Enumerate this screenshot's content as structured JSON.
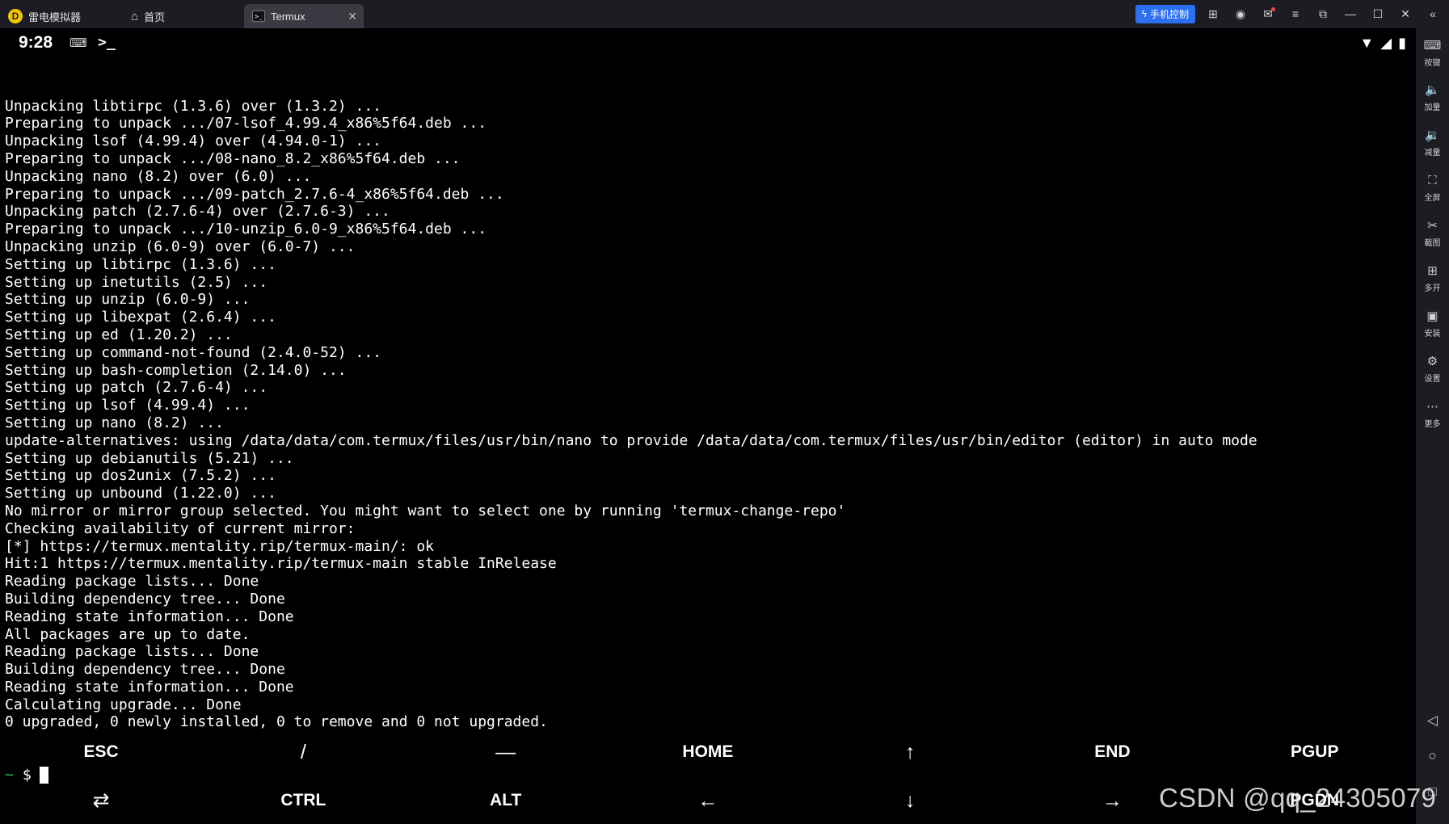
{
  "titlebar": {
    "tabs": [
      {
        "label": "雷电模拟器",
        "icon": "leidian-logo-icon"
      },
      {
        "label": "首页",
        "icon": "home-icon"
      },
      {
        "label": "Termux",
        "icon": "termux-icon",
        "active": true
      }
    ],
    "phone_control_label": "手机控制",
    "right_icons": [
      "gamepad-icon",
      "user-icon",
      "mail-icon",
      "menu-icon",
      "window-restore-icon",
      "minimize-icon",
      "maximize-icon",
      "close-icon",
      "collapse-icon"
    ],
    "accent_color": "#2c6ff0"
  },
  "statusbar": {
    "time": "9:28",
    "icons": [
      "keyboard-icon",
      "terminal-prompt-icon",
      "wifi-icon",
      "signal-icon",
      "battery-icon"
    ]
  },
  "terminal": {
    "lines": [
      "Unpacking libtirpc (1.3.6) over (1.3.2) ...",
      "Preparing to unpack .../07-lsof_4.99.4_x86%5f64.deb ...",
      "Unpacking lsof (4.99.4) over (4.94.0-1) ...",
      "Preparing to unpack .../08-nano_8.2_x86%5f64.deb ...",
      "Unpacking nano (8.2) over (6.0) ...",
      "Preparing to unpack .../09-patch_2.7.6-4_x86%5f64.deb ...",
      "Unpacking patch (2.7.6-4) over (2.7.6-3) ...",
      "Preparing to unpack .../10-unzip_6.0-9_x86%5f64.deb ...",
      "Unpacking unzip (6.0-9) over (6.0-7) ...",
      "Setting up libtirpc (1.3.6) ...",
      "Setting up inetutils (2.5) ...",
      "Setting up unzip (6.0-9) ...",
      "Setting up libexpat (2.6.4) ...",
      "Setting up ed (1.20.2) ...",
      "Setting up command-not-found (2.4.0-52) ...",
      "Setting up bash-completion (2.14.0) ...",
      "Setting up patch (2.7.6-4) ...",
      "Setting up lsof (4.99.4) ...",
      "Setting up nano (8.2) ...",
      "update-alternatives: using /data/data/com.termux/files/usr/bin/nano to provide /data/data/com.termux/files/usr/bin/editor (editor) in auto mode",
      "Setting up debianutils (5.21) ...",
      "Setting up dos2unix (7.5.2) ...",
      "Setting up unbound (1.22.0) ...",
      "No mirror or mirror group selected. You might want to select one by running 'termux-change-repo'",
      "Checking availability of current mirror:",
      "[*] https://termux.mentality.rip/termux-main/: ok",
      "Hit:1 https://termux.mentality.rip/termux-main stable InRelease",
      "Reading package lists... Done",
      "Building dependency tree... Done",
      "Reading state information... Done",
      "All packages are up to date.",
      "Reading package lists... Done",
      "Building dependency tree... Done",
      "Reading state information... Done",
      "Calculating upgrade... Done",
      "0 upgraded, 0 newly installed, 0 to remove and 0 not upgraded."
    ],
    "prompt_tilde": "~",
    "prompt_symbol": "$",
    "prompt_color": "#2fc34b"
  },
  "extra_keys": {
    "row1": [
      "ESC",
      "/",
      "—",
      "HOME",
      "↑",
      "END",
      "PGUP"
    ],
    "row2": [
      "⇄",
      "CTRL",
      "ALT",
      "←",
      "↓",
      "→",
      "PGDN"
    ]
  },
  "sidebar": {
    "items": [
      {
        "label": "按键",
        "icon": "keyboard-map-icon"
      },
      {
        "label": "加量",
        "icon": "volume-up-icon"
      },
      {
        "label": "减量",
        "icon": "volume-down-icon"
      },
      {
        "label": "全屏",
        "icon": "fullscreen-icon"
      },
      {
        "label": "截图",
        "icon": "scissors-icon"
      },
      {
        "label": "多开",
        "icon": "multi-instance-icon"
      },
      {
        "label": "安装",
        "icon": "apk-install-icon"
      },
      {
        "label": "设置",
        "icon": "settings-icon"
      },
      {
        "label": "更多",
        "icon": "more-icon"
      }
    ],
    "nav": [
      "back-icon",
      "home-circle-icon",
      "recents-icon"
    ]
  },
  "watermark": "CSDN @qq_24305079"
}
